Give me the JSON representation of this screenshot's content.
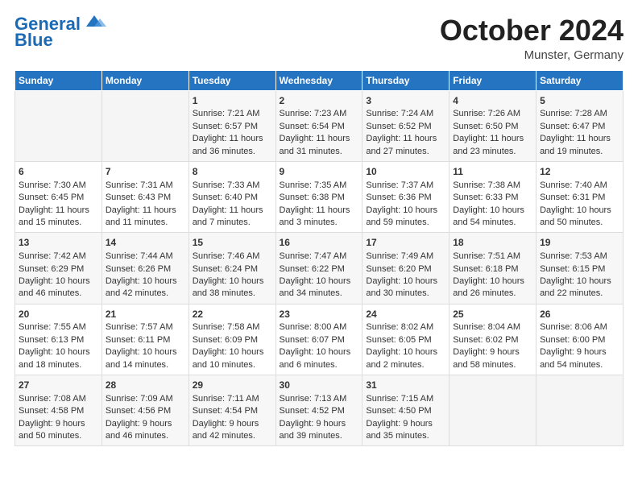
{
  "header": {
    "logo_line1": "General",
    "logo_line2": "Blue",
    "month": "October 2024",
    "location": "Munster, Germany"
  },
  "days_of_week": [
    "Sunday",
    "Monday",
    "Tuesday",
    "Wednesday",
    "Thursday",
    "Friday",
    "Saturday"
  ],
  "weeks": [
    [
      {
        "day": "",
        "sunrise": "",
        "sunset": "",
        "daylight": ""
      },
      {
        "day": "",
        "sunrise": "",
        "sunset": "",
        "daylight": ""
      },
      {
        "day": "1",
        "sunrise": "Sunrise: 7:21 AM",
        "sunset": "Sunset: 6:57 PM",
        "daylight": "Daylight: 11 hours and 36 minutes."
      },
      {
        "day": "2",
        "sunrise": "Sunrise: 7:23 AM",
        "sunset": "Sunset: 6:54 PM",
        "daylight": "Daylight: 11 hours and 31 minutes."
      },
      {
        "day": "3",
        "sunrise": "Sunrise: 7:24 AM",
        "sunset": "Sunset: 6:52 PM",
        "daylight": "Daylight: 11 hours and 27 minutes."
      },
      {
        "day": "4",
        "sunrise": "Sunrise: 7:26 AM",
        "sunset": "Sunset: 6:50 PM",
        "daylight": "Daylight: 11 hours and 23 minutes."
      },
      {
        "day": "5",
        "sunrise": "Sunrise: 7:28 AM",
        "sunset": "Sunset: 6:47 PM",
        "daylight": "Daylight: 11 hours and 19 minutes."
      }
    ],
    [
      {
        "day": "6",
        "sunrise": "Sunrise: 7:30 AM",
        "sunset": "Sunset: 6:45 PM",
        "daylight": "Daylight: 11 hours and 15 minutes."
      },
      {
        "day": "7",
        "sunrise": "Sunrise: 7:31 AM",
        "sunset": "Sunset: 6:43 PM",
        "daylight": "Daylight: 11 hours and 11 minutes."
      },
      {
        "day": "8",
        "sunrise": "Sunrise: 7:33 AM",
        "sunset": "Sunset: 6:40 PM",
        "daylight": "Daylight: 11 hours and 7 minutes."
      },
      {
        "day": "9",
        "sunrise": "Sunrise: 7:35 AM",
        "sunset": "Sunset: 6:38 PM",
        "daylight": "Daylight: 11 hours and 3 minutes."
      },
      {
        "day": "10",
        "sunrise": "Sunrise: 7:37 AM",
        "sunset": "Sunset: 6:36 PM",
        "daylight": "Daylight: 10 hours and 59 minutes."
      },
      {
        "day": "11",
        "sunrise": "Sunrise: 7:38 AM",
        "sunset": "Sunset: 6:33 PM",
        "daylight": "Daylight: 10 hours and 54 minutes."
      },
      {
        "day": "12",
        "sunrise": "Sunrise: 7:40 AM",
        "sunset": "Sunset: 6:31 PM",
        "daylight": "Daylight: 10 hours and 50 minutes."
      }
    ],
    [
      {
        "day": "13",
        "sunrise": "Sunrise: 7:42 AM",
        "sunset": "Sunset: 6:29 PM",
        "daylight": "Daylight: 10 hours and 46 minutes."
      },
      {
        "day": "14",
        "sunrise": "Sunrise: 7:44 AM",
        "sunset": "Sunset: 6:26 PM",
        "daylight": "Daylight: 10 hours and 42 minutes."
      },
      {
        "day": "15",
        "sunrise": "Sunrise: 7:46 AM",
        "sunset": "Sunset: 6:24 PM",
        "daylight": "Daylight: 10 hours and 38 minutes."
      },
      {
        "day": "16",
        "sunrise": "Sunrise: 7:47 AM",
        "sunset": "Sunset: 6:22 PM",
        "daylight": "Daylight: 10 hours and 34 minutes."
      },
      {
        "day": "17",
        "sunrise": "Sunrise: 7:49 AM",
        "sunset": "Sunset: 6:20 PM",
        "daylight": "Daylight: 10 hours and 30 minutes."
      },
      {
        "day": "18",
        "sunrise": "Sunrise: 7:51 AM",
        "sunset": "Sunset: 6:18 PM",
        "daylight": "Daylight: 10 hours and 26 minutes."
      },
      {
        "day": "19",
        "sunrise": "Sunrise: 7:53 AM",
        "sunset": "Sunset: 6:15 PM",
        "daylight": "Daylight: 10 hours and 22 minutes."
      }
    ],
    [
      {
        "day": "20",
        "sunrise": "Sunrise: 7:55 AM",
        "sunset": "Sunset: 6:13 PM",
        "daylight": "Daylight: 10 hours and 18 minutes."
      },
      {
        "day": "21",
        "sunrise": "Sunrise: 7:57 AM",
        "sunset": "Sunset: 6:11 PM",
        "daylight": "Daylight: 10 hours and 14 minutes."
      },
      {
        "day": "22",
        "sunrise": "Sunrise: 7:58 AM",
        "sunset": "Sunset: 6:09 PM",
        "daylight": "Daylight: 10 hours and 10 minutes."
      },
      {
        "day": "23",
        "sunrise": "Sunrise: 8:00 AM",
        "sunset": "Sunset: 6:07 PM",
        "daylight": "Daylight: 10 hours and 6 minutes."
      },
      {
        "day": "24",
        "sunrise": "Sunrise: 8:02 AM",
        "sunset": "Sunset: 6:05 PM",
        "daylight": "Daylight: 10 hours and 2 minutes."
      },
      {
        "day": "25",
        "sunrise": "Sunrise: 8:04 AM",
        "sunset": "Sunset: 6:02 PM",
        "daylight": "Daylight: 9 hours and 58 minutes."
      },
      {
        "day": "26",
        "sunrise": "Sunrise: 8:06 AM",
        "sunset": "Sunset: 6:00 PM",
        "daylight": "Daylight: 9 hours and 54 minutes."
      }
    ],
    [
      {
        "day": "27",
        "sunrise": "Sunrise: 7:08 AM",
        "sunset": "Sunset: 4:58 PM",
        "daylight": "Daylight: 9 hours and 50 minutes."
      },
      {
        "day": "28",
        "sunrise": "Sunrise: 7:09 AM",
        "sunset": "Sunset: 4:56 PM",
        "daylight": "Daylight: 9 hours and 46 minutes."
      },
      {
        "day": "29",
        "sunrise": "Sunrise: 7:11 AM",
        "sunset": "Sunset: 4:54 PM",
        "daylight": "Daylight: 9 hours and 42 minutes."
      },
      {
        "day": "30",
        "sunrise": "Sunrise: 7:13 AM",
        "sunset": "Sunset: 4:52 PM",
        "daylight": "Daylight: 9 hours and 39 minutes."
      },
      {
        "day": "31",
        "sunrise": "Sunrise: 7:15 AM",
        "sunset": "Sunset: 4:50 PM",
        "daylight": "Daylight: 9 hours and 35 minutes."
      },
      {
        "day": "",
        "sunrise": "",
        "sunset": "",
        "daylight": ""
      },
      {
        "day": "",
        "sunrise": "",
        "sunset": "",
        "daylight": ""
      }
    ]
  ]
}
